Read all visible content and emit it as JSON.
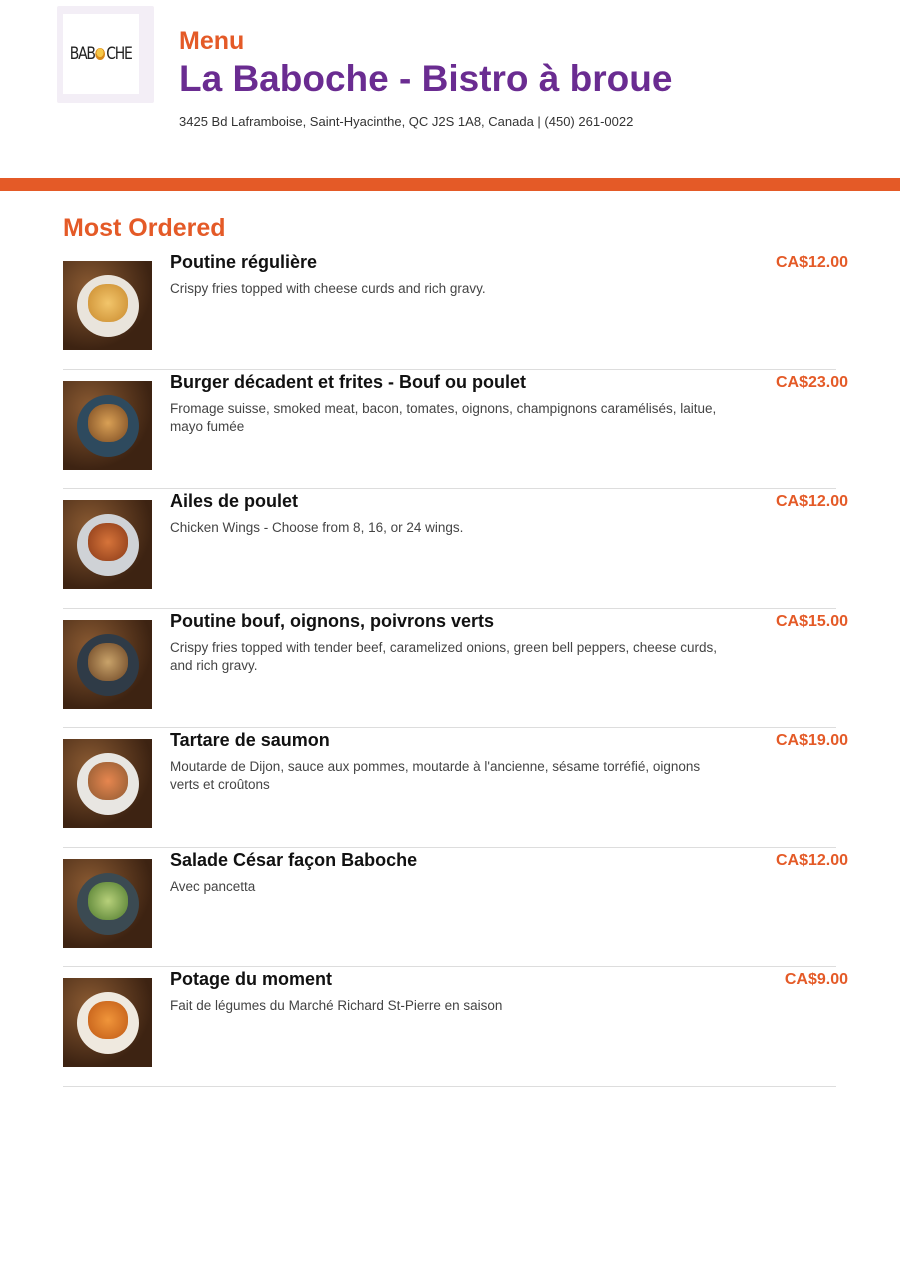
{
  "header": {
    "logo_text": "BABOCHE",
    "menu_label": "Menu",
    "restaurant_name": "La Baboche - Bistro à broue",
    "address": "3425 Bd Laframboise, Saint-Hyacinthe, QC J2S 1A8, Canada | (450) 261-0022"
  },
  "colors": {
    "accent": "#e45a27",
    "brand_purple": "#6a2c91"
  },
  "section": {
    "title": "Most Ordered"
  },
  "items": [
    {
      "name": "Poutine régulière",
      "description": "Crispy fries topped with cheese curds and rich gravy.",
      "price": "CA$12.00",
      "image": "poutine-photo"
    },
    {
      "name": "Burger décadent et frites - Bouf ou poulet",
      "description": "Fromage suisse, smoked meat, bacon, tomates, oignons, champignons caramélisés, laitue, mayo fumée",
      "price": "CA$23.00",
      "image": "burger-photo"
    },
    {
      "name": "Ailes de poulet",
      "description": "Chicken Wings - Choose from 8, 16, or 24 wings.",
      "price": "CA$12.00",
      "image": "chicken-wings-photo"
    },
    {
      "name": "Poutine bouf, oignons, poivrons verts",
      "description": "Crispy fries topped with tender beef, caramelized onions, green bell peppers, cheese curds, and rich gravy.",
      "price": "CA$15.00",
      "image": "beef-poutine-photo"
    },
    {
      "name": "Tartare de saumon",
      "description": "Moutarde de Dijon, sauce aux pommes, moutarde à l'ancienne, sésame torréfié, oignons verts et croûtons",
      "price": "CA$19.00",
      "image": "salmon-tartare-photo"
    },
    {
      "name": "Salade César façon Baboche",
      "description": "Avec pancetta",
      "price": "CA$12.00",
      "image": "caesar-salad-photo"
    },
    {
      "name": "Potage du moment",
      "description": "Fait de légumes du Marché Richard St-Pierre en saison",
      "price": "CA$9.00",
      "image": "soup-photo"
    }
  ]
}
